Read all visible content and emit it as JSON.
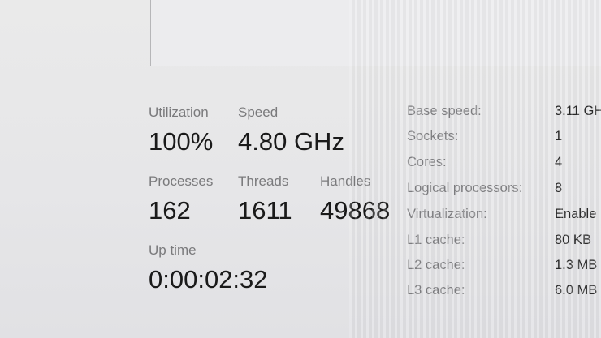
{
  "stats": {
    "utilization": {
      "label": "Utilization",
      "value": "100%"
    },
    "speed": {
      "label": "Speed",
      "value": "4.80 GHz"
    },
    "processes": {
      "label": "Processes",
      "value": "162"
    },
    "threads": {
      "label": "Threads",
      "value": "1611"
    },
    "handles": {
      "label": "Handles",
      "value": "49868"
    },
    "uptime": {
      "label": "Up time",
      "value": "0:00:02:32"
    }
  },
  "specs": [
    {
      "key": "Base speed:",
      "value": "3.11 GH"
    },
    {
      "key": "Sockets:",
      "value": "1"
    },
    {
      "key": "Cores:",
      "value": "4"
    },
    {
      "key": "Logical processors:",
      "value": "8"
    },
    {
      "key": "Virtualization:",
      "value": "Enable"
    },
    {
      "key": "L1 cache:",
      "value": "80 KB"
    },
    {
      "key": "L2 cache:",
      "value": "1.3 MB"
    },
    {
      "key": "L3 cache:",
      "value": "6.0 MB"
    }
  ]
}
